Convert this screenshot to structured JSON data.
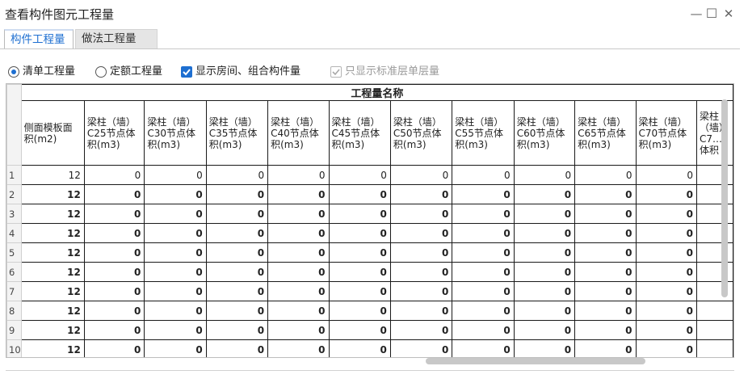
{
  "window": {
    "title": "查看构件图元工程量",
    "minimize": "—",
    "maximize": "☐",
    "close": "✕"
  },
  "tabs": [
    {
      "label": "构件工程量",
      "active": true
    },
    {
      "label": "做法工程量",
      "active": false
    }
  ],
  "options": {
    "radio_qd": {
      "label": "清单工程量",
      "checked": true
    },
    "radio_de": {
      "label": "定额工程量",
      "checked": false
    },
    "chk_room": {
      "label": "显示房间、组合构件量",
      "checked": true
    },
    "chk_std": {
      "label": "只显示标准层单层量",
      "checked": true,
      "disabled": true
    }
  },
  "table": {
    "group_header": "工程量名称",
    "columns": [
      "侧面模板面积(m2)",
      "梁柱（墙）C25节点体积(m3)",
      "梁柱（墙）C30节点体积(m3)",
      "梁柱（墙）C35节点体积(m3)",
      "梁柱（墙）C40节点体积(m3)",
      "梁柱（墙）C45节点体积(m3)",
      "梁柱（墙）C50节点体积(m3)",
      "梁柱（墙）C55节点体积(m3)",
      "梁柱（墙）C60节点体积(m3)",
      "梁柱（墙）C65节点体积(m3)",
      "梁柱（墙）C70节点体积(m3)",
      "梁柱（墙）C7…体积"
    ],
    "rows": [
      {
        "num": "1",
        "bold": false,
        "values": [
          "12",
          "0",
          "0",
          "0",
          "0",
          "0",
          "0",
          "0",
          "0",
          "0",
          "0"
        ]
      },
      {
        "num": "2",
        "bold": true,
        "values": [
          "12",
          "0",
          "0",
          "0",
          "0",
          "0",
          "0",
          "0",
          "0",
          "0",
          "0"
        ]
      },
      {
        "num": "3",
        "bold": true,
        "values": [
          "12",
          "0",
          "0",
          "0",
          "0",
          "0",
          "0",
          "0",
          "0",
          "0",
          "0"
        ]
      },
      {
        "num": "4",
        "bold": true,
        "values": [
          "12",
          "0",
          "0",
          "0",
          "0",
          "0",
          "0",
          "0",
          "0",
          "0",
          "0"
        ]
      },
      {
        "num": "5",
        "bold": true,
        "values": [
          "12",
          "0",
          "0",
          "0",
          "0",
          "0",
          "0",
          "0",
          "0",
          "0",
          "0"
        ]
      },
      {
        "num": "6",
        "bold": true,
        "values": [
          "12",
          "0",
          "0",
          "0",
          "0",
          "0",
          "0",
          "0",
          "0",
          "0",
          "0"
        ]
      },
      {
        "num": "7",
        "bold": true,
        "values": [
          "12",
          "0",
          "0",
          "0",
          "0",
          "0",
          "0",
          "0",
          "0",
          "0",
          "0"
        ]
      },
      {
        "num": "8",
        "bold": true,
        "values": [
          "12",
          "0",
          "0",
          "0",
          "0",
          "0",
          "0",
          "0",
          "0",
          "0",
          "0"
        ]
      },
      {
        "num": "9",
        "bold": true,
        "values": [
          "12",
          "0",
          "0",
          "0",
          "0",
          "0",
          "0",
          "0",
          "0",
          "0",
          "0"
        ]
      },
      {
        "num": "10",
        "bold": true,
        "values": [
          "12",
          "0",
          "0",
          "0",
          "0",
          "0",
          "0",
          "0",
          "0",
          "0",
          "0"
        ]
      }
    ]
  },
  "colors": {
    "accent": "#1e6fd1",
    "grid": "#1a1a1a",
    "header_bg": "#f3f3f3"
  }
}
